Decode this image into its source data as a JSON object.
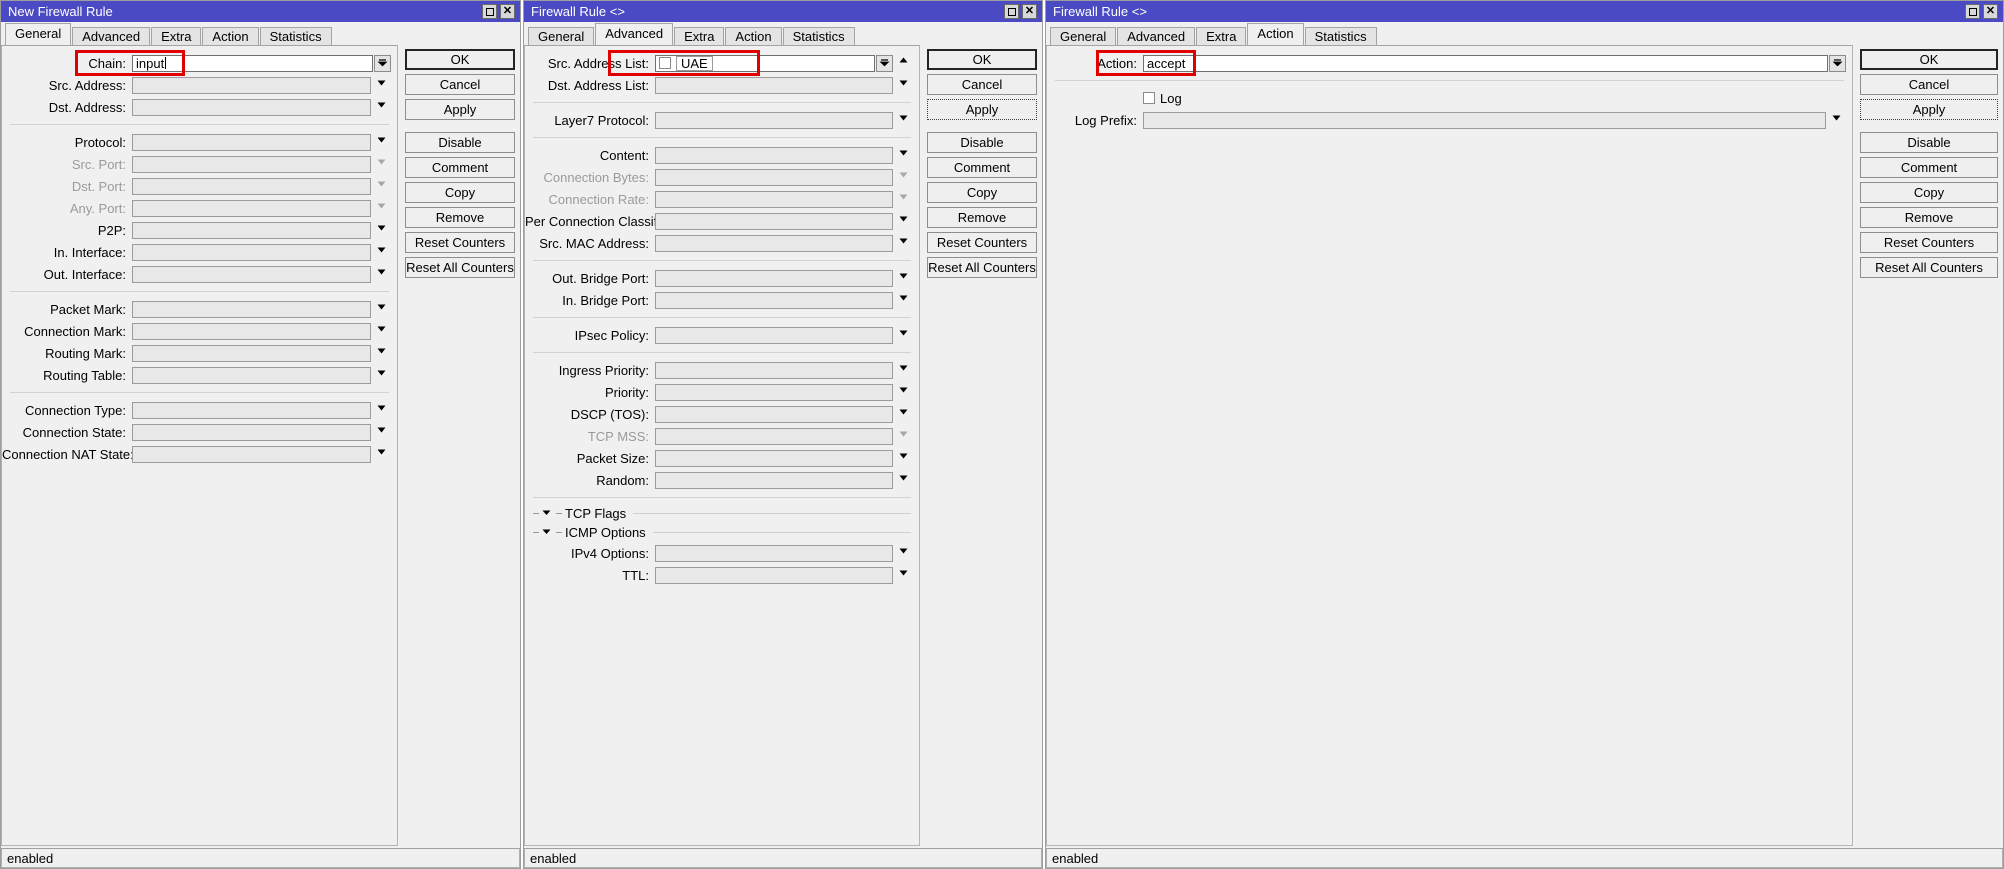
{
  "windows": [
    {
      "title": "New Firewall Rule",
      "has_window_buttons": true,
      "maximize_icon": "maximize-icon",
      "close_icon": "close-icon",
      "tabs": [
        {
          "label": "General",
          "active": true
        },
        {
          "label": "Advanced",
          "active": false
        },
        {
          "label": "Extra",
          "active": false
        },
        {
          "label": "Action",
          "active": false
        },
        {
          "label": "Statistics",
          "active": false
        }
      ],
      "groups": [
        {
          "rows": [
            {
              "label": "Chain:",
              "value": "input",
              "editing": true,
              "editable": true,
              "control": "dropbutton",
              "highlight": true
            },
            {
              "label": "Src. Address:",
              "value": "",
              "control": "arrow"
            },
            {
              "label": "Dst. Address:",
              "value": "",
              "control": "arrow"
            }
          ]
        },
        {
          "rows": [
            {
              "label": "Protocol:",
              "value": "",
              "control": "arrow"
            },
            {
              "label": "Src. Port:",
              "value": "",
              "control": "arrow",
              "disabled": true
            },
            {
              "label": "Dst. Port:",
              "value": "",
              "control": "arrow",
              "disabled": true
            },
            {
              "label": "Any. Port:",
              "value": "",
              "control": "arrow",
              "disabled": true
            },
            {
              "label": "P2P:",
              "value": "",
              "control": "arrow"
            },
            {
              "label": "In. Interface:",
              "value": "",
              "control": "arrow"
            },
            {
              "label": "Out. Interface:",
              "value": "",
              "control": "arrow"
            }
          ]
        },
        {
          "rows": [
            {
              "label": "Packet Mark:",
              "value": "",
              "control": "arrow"
            },
            {
              "label": "Connection Mark:",
              "value": "",
              "control": "arrow"
            },
            {
              "label": "Routing Mark:",
              "value": "",
              "control": "arrow"
            },
            {
              "label": "Routing Table:",
              "value": "",
              "control": "arrow"
            }
          ]
        },
        {
          "rows": [
            {
              "label": "Connection Type:",
              "value": "",
              "control": "arrow"
            },
            {
              "label": "Connection State:",
              "value": "",
              "control": "arrow"
            },
            {
              "label": "Connection NAT State:",
              "value": "",
              "control": "arrow"
            }
          ]
        }
      ],
      "label_width": 130,
      "buttons": [
        {
          "label": "OK",
          "style": "default"
        },
        {
          "label": "Cancel",
          "style": "normal"
        },
        {
          "label": "Apply",
          "style": "normal"
        },
        {
          "gap": true
        },
        {
          "label": "Disable",
          "style": "normal"
        },
        {
          "label": "Comment",
          "style": "normal"
        },
        {
          "label": "Copy",
          "style": "normal"
        },
        {
          "label": "Remove",
          "style": "normal"
        },
        {
          "label": "Reset Counters",
          "style": "normal"
        },
        {
          "label": "Reset All Counters",
          "style": "normal"
        }
      ],
      "status": "enabled"
    },
    {
      "title": "Firewall Rule <>",
      "has_window_buttons": true,
      "maximize_icon": "maximize-icon",
      "close_icon": "close-icon",
      "tabs": [
        {
          "label": "General",
          "active": false
        },
        {
          "label": "Advanced",
          "active": true
        },
        {
          "label": "Extra",
          "active": false
        },
        {
          "label": "Action",
          "active": false
        },
        {
          "label": "Statistics",
          "active": false
        }
      ],
      "groups": [
        {
          "rows": [
            {
              "label": "Src. Address List:",
              "value": "UAE",
              "checkbox": true,
              "chip": true,
              "control": "dropbutton",
              "extra_control": "up-arrow",
              "highlight": true
            },
            {
              "label": "Dst. Address List:",
              "value": "",
              "control": "arrow"
            }
          ]
        },
        {
          "rows": [
            {
              "label": "Layer7 Protocol:",
              "value": "",
              "control": "arrow"
            }
          ]
        },
        {
          "rows": [
            {
              "label": "Content:",
              "value": "",
              "control": "arrow"
            },
            {
              "label": "Connection Bytes:",
              "value": "",
              "control": "arrow",
              "disabled": true
            },
            {
              "label": "Connection Rate:",
              "value": "",
              "control": "arrow",
              "disabled": true
            },
            {
              "label": "Per Connection Classifier:",
              "value": "",
              "control": "arrow"
            },
            {
              "label": "Src. MAC Address:",
              "value": "",
              "control": "arrow"
            }
          ]
        },
        {
          "rows": [
            {
              "label": "Out. Bridge Port:",
              "value": "",
              "control": "arrow"
            },
            {
              "label": "In. Bridge Port:",
              "value": "",
              "control": "arrow"
            }
          ]
        },
        {
          "rows": [
            {
              "label": "IPsec Policy:",
              "value": "",
              "control": "arrow"
            }
          ]
        },
        {
          "rows": [
            {
              "label": "Ingress Priority:",
              "value": "",
              "control": "arrow"
            },
            {
              "label": "Priority:",
              "value": "",
              "control": "arrow"
            },
            {
              "label": "DSCP (TOS):",
              "value": "",
              "control": "arrow"
            },
            {
              "label": "TCP MSS:",
              "value": "",
              "control": "arrow",
              "disabled": true
            },
            {
              "label": "Packet Size:",
              "value": "",
              "control": "arrow"
            },
            {
              "label": "Random:",
              "value": "",
              "control": "arrow"
            }
          ]
        }
      ],
      "collapsibles": [
        {
          "label": "TCP Flags",
          "expanded": false,
          "icon": "chevron-down-icon",
          "rows": []
        },
        {
          "label": "ICMP Options",
          "expanded": true,
          "icon": "chevron-down-icon",
          "rows": [
            {
              "label": "IPv4 Options:",
              "value": "",
              "control": "arrow"
            },
            {
              "label": "TTL:",
              "value": "",
              "control": "arrow"
            }
          ]
        }
      ],
      "label_width": 130,
      "buttons": [
        {
          "label": "OK",
          "style": "default"
        },
        {
          "label": "Cancel",
          "style": "normal"
        },
        {
          "label": "Apply",
          "style": "focus"
        },
        {
          "gap": true
        },
        {
          "label": "Disable",
          "style": "normal"
        },
        {
          "label": "Comment",
          "style": "normal"
        },
        {
          "label": "Copy",
          "style": "normal"
        },
        {
          "label": "Remove",
          "style": "normal"
        },
        {
          "label": "Reset Counters",
          "style": "normal"
        },
        {
          "label": "Reset All Counters",
          "style": "normal"
        }
      ],
      "status": "enabled"
    },
    {
      "title": "Firewall Rule <>",
      "has_window_buttons": true,
      "maximize_icon": "maximize-icon",
      "close_icon": "close-icon",
      "tabs": [
        {
          "label": "General",
          "active": false
        },
        {
          "label": "Advanced",
          "active": false
        },
        {
          "label": "Extra",
          "active": false
        },
        {
          "label": "Action",
          "active": true
        },
        {
          "label": "Statistics",
          "active": false
        }
      ],
      "groups": [
        {
          "rows": [
            {
              "label": "Action:",
              "value": "accept",
              "editable": true,
              "control": "dropbutton",
              "highlight": true
            }
          ]
        },
        {
          "rows": [
            {
              "label": "",
              "value": "",
              "checkbox_label": "Log",
              "control": "none"
            },
            {
              "label": "Log Prefix:",
              "value": "",
              "control": "arrow"
            }
          ]
        }
      ],
      "label_width": 96,
      "buttons": [
        {
          "label": "OK",
          "style": "default"
        },
        {
          "label": "Cancel",
          "style": "normal"
        },
        {
          "label": "Apply",
          "style": "focus"
        },
        {
          "gap": true
        },
        {
          "label": "Disable",
          "style": "normal"
        },
        {
          "label": "Comment",
          "style": "normal"
        },
        {
          "label": "Copy",
          "style": "normal"
        },
        {
          "label": "Remove",
          "style": "normal"
        },
        {
          "label": "Reset Counters",
          "style": "normal"
        },
        {
          "label": "Reset All Counters",
          "style": "normal"
        }
      ],
      "status": "enabled"
    }
  ],
  "colors": {
    "titlebar": "#4a4ac4",
    "highlight": "#e10000",
    "face": "#f0f0f0",
    "field_disabled": "#e8e8e8"
  }
}
